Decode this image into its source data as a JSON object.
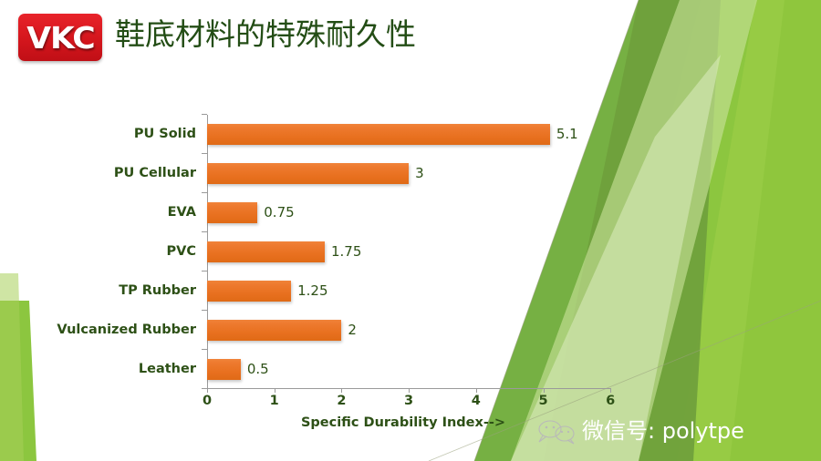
{
  "brand": {
    "logo_text": "VKC",
    "logo_color": "#d4161d"
  },
  "slide": {
    "title": "鞋底材料的特殊耐久性",
    "title_color": "#234d15",
    "background": "#ffffff",
    "accent_greens": [
      "#8cc63f",
      "#76b043",
      "#a8d05a",
      "#c8e29a",
      "#dcecc0",
      "#6fa03c"
    ]
  },
  "watermark": {
    "icon": "wechat-chat-icon",
    "text": "微信号: polytpe",
    "color": "#ffffff"
  },
  "chart_data": {
    "type": "bar",
    "orientation": "horizontal",
    "title": "",
    "xlabel": "Specific Durability Index-->",
    "ylabel": "",
    "categories": [
      "PU Solid",
      "PU Cellular",
      "EVA",
      "PVC",
      "TP Rubber",
      "Vulcanized Rubber",
      "Leather"
    ],
    "values": [
      5.1,
      3,
      0.75,
      1.75,
      1.25,
      2,
      0.5
    ],
    "value_labels": [
      "5.1",
      "3",
      "0.75",
      "1.75",
      "1.25",
      "2",
      "0.5"
    ],
    "xticks": [
      0,
      1,
      2,
      3,
      4,
      5,
      6
    ],
    "xtick_labels": [
      "0",
      "1",
      "2",
      "3",
      "4",
      "5",
      "6"
    ],
    "xlim": [
      0,
      6
    ],
    "grid": false,
    "legend": false,
    "bar_color": "#e8701f",
    "label_color": "#2d5016"
  }
}
